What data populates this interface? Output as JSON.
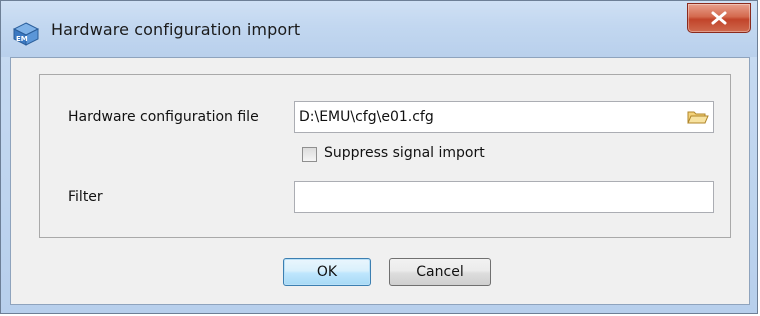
{
  "window": {
    "title": "Hardware configuration import",
    "app_icon": "emu-app-icon",
    "close_icon": "close-icon"
  },
  "form": {
    "hw_config_label": "Hardware configuration file",
    "hw_config_value": "D:\\EMU\\cfg\\e01.cfg",
    "browse_icon": "folder-open-icon",
    "suppress_label": "Suppress signal import",
    "suppress_checked": false,
    "filter_label": "Filter",
    "filter_value": ""
  },
  "buttons": {
    "ok_label": "OK",
    "cancel_label": "Cancel"
  }
}
